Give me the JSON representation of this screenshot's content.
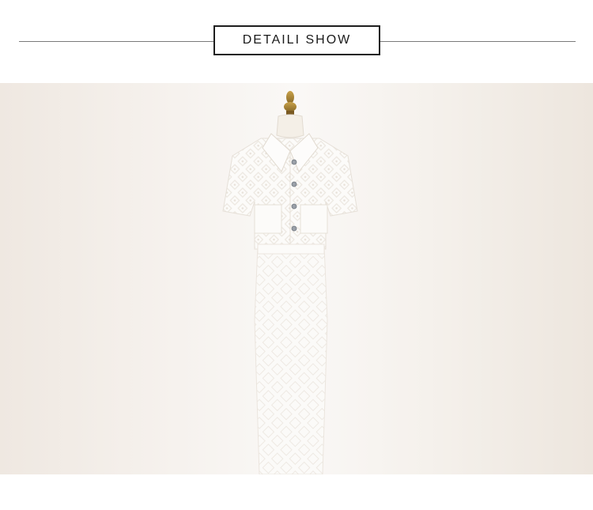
{
  "header": {
    "title": "DETAILI SHOW"
  },
  "photo": {
    "subject": "white-lace-shirt-and-skirt-on-mannequin",
    "background_color": "#f4efe9",
    "garment_color": "#fbfaf8"
  }
}
